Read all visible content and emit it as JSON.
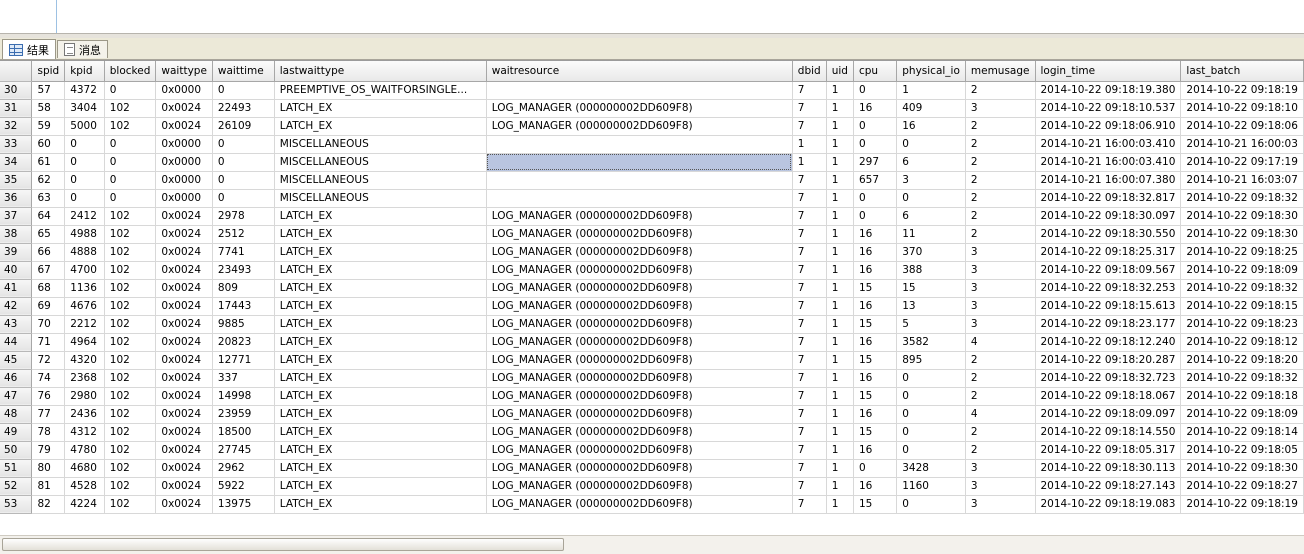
{
  "tabs": [
    {
      "label": "结果",
      "icon": "grid-results-icon",
      "active": true
    },
    {
      "label": "消息",
      "icon": "messages-icon",
      "active": false
    }
  ],
  "grid": {
    "columns": [
      "spid",
      "kpid",
      "blocked",
      "waittype",
      "waittime",
      "lastwaittype",
      "waitresource",
      "dbid",
      "uid",
      "cpu",
      "physical_io",
      "memusage",
      "login_time",
      "last_batch"
    ],
    "rows": [
      [
        "30",
        "57",
        "4372",
        "0",
        "0x0000",
        "0",
        "PREEMPTIVE_OS_WAITFORSINGLE...",
        "",
        "7",
        "1",
        "0",
        "1",
        "2",
        "2014-10-22 09:18:19.380",
        "2014-10-22 09:18:19"
      ],
      [
        "31",
        "58",
        "3404",
        "102",
        "0x0024",
        "22493",
        "LATCH_EX",
        "LOG_MANAGER (000000002DD609F8)",
        "7",
        "1",
        "16",
        "409",
        "3",
        "2014-10-22 09:18:10.537",
        "2014-10-22 09:18:10"
      ],
      [
        "32",
        "59",
        "5000",
        "102",
        "0x0024",
        "26109",
        "LATCH_EX",
        "LOG_MANAGER (000000002DD609F8)",
        "7",
        "1",
        "0",
        "16",
        "2",
        "2014-10-22 09:18:06.910",
        "2014-10-22 09:18:06"
      ],
      [
        "33",
        "60",
        "0",
        "0",
        "0x0000",
        "0",
        "MISCELLANEOUS",
        "",
        "1",
        "1",
        "0",
        "0",
        "2",
        "2014-10-21 16:00:03.410",
        "2014-10-21 16:00:03"
      ],
      [
        "34",
        "61",
        "0",
        "0",
        "0x0000",
        "0",
        "MISCELLANEOUS",
        "",
        "1",
        "1",
        "297",
        "6",
        "2",
        "2014-10-21 16:00:03.410",
        "2014-10-22 09:17:19"
      ],
      [
        "35",
        "62",
        "0",
        "0",
        "0x0000",
        "0",
        "MISCELLANEOUS",
        "",
        "7",
        "1",
        "657",
        "3",
        "2",
        "2014-10-21 16:00:07.380",
        "2014-10-21 16:03:07"
      ],
      [
        "36",
        "63",
        "0",
        "0",
        "0x0000",
        "0",
        "MISCELLANEOUS",
        "",
        "7",
        "1",
        "0",
        "0",
        "2",
        "2014-10-22 09:18:32.817",
        "2014-10-22 09:18:32"
      ],
      [
        "37",
        "64",
        "2412",
        "102",
        "0x0024",
        "2978",
        "LATCH_EX",
        "LOG_MANAGER (000000002DD609F8)",
        "7",
        "1",
        "0",
        "6",
        "2",
        "2014-10-22 09:18:30.097",
        "2014-10-22 09:18:30"
      ],
      [
        "38",
        "65",
        "4988",
        "102",
        "0x0024",
        "2512",
        "LATCH_EX",
        "LOG_MANAGER (000000002DD609F8)",
        "7",
        "1",
        "16",
        "11",
        "2",
        "2014-10-22 09:18:30.550",
        "2014-10-22 09:18:30"
      ],
      [
        "39",
        "66",
        "4888",
        "102",
        "0x0024",
        "7741",
        "LATCH_EX",
        "LOG_MANAGER (000000002DD609F8)",
        "7",
        "1",
        "16",
        "370",
        "3",
        "2014-10-22 09:18:25.317",
        "2014-10-22 09:18:25"
      ],
      [
        "40",
        "67",
        "4700",
        "102",
        "0x0024",
        "23493",
        "LATCH_EX",
        "LOG_MANAGER (000000002DD609F8)",
        "7",
        "1",
        "16",
        "388",
        "3",
        "2014-10-22 09:18:09.567",
        "2014-10-22 09:18:09"
      ],
      [
        "41",
        "68",
        "1136",
        "102",
        "0x0024",
        "809",
        "LATCH_EX",
        "LOG_MANAGER (000000002DD609F8)",
        "7",
        "1",
        "15",
        "15",
        "3",
        "2014-10-22 09:18:32.253",
        "2014-10-22 09:18:32"
      ],
      [
        "42",
        "69",
        "4676",
        "102",
        "0x0024",
        "17443",
        "LATCH_EX",
        "LOG_MANAGER (000000002DD609F8)",
        "7",
        "1",
        "16",
        "13",
        "3",
        "2014-10-22 09:18:15.613",
        "2014-10-22 09:18:15"
      ],
      [
        "43",
        "70",
        "2212",
        "102",
        "0x0024",
        "9885",
        "LATCH_EX",
        "LOG_MANAGER (000000002DD609F8)",
        "7",
        "1",
        "15",
        "5",
        "3",
        "2014-10-22 09:18:23.177",
        "2014-10-22 09:18:23"
      ],
      [
        "44",
        "71",
        "4964",
        "102",
        "0x0024",
        "20823",
        "LATCH_EX",
        "LOG_MANAGER (000000002DD609F8)",
        "7",
        "1",
        "16",
        "3582",
        "4",
        "2014-10-22 09:18:12.240",
        "2014-10-22 09:18:12"
      ],
      [
        "45",
        "72",
        "4320",
        "102",
        "0x0024",
        "12771",
        "LATCH_EX",
        "LOG_MANAGER (000000002DD609F8)",
        "7",
        "1",
        "15",
        "895",
        "2",
        "2014-10-22 09:18:20.287",
        "2014-10-22 09:18:20"
      ],
      [
        "46",
        "74",
        "2368",
        "102",
        "0x0024",
        "337",
        "LATCH_EX",
        "LOG_MANAGER (000000002DD609F8)",
        "7",
        "1",
        "16",
        "0",
        "2",
        "2014-10-22 09:18:32.723",
        "2014-10-22 09:18:32"
      ],
      [
        "47",
        "76",
        "2980",
        "102",
        "0x0024",
        "14998",
        "LATCH_EX",
        "LOG_MANAGER (000000002DD609F8)",
        "7",
        "1",
        "15",
        "0",
        "2",
        "2014-10-22 09:18:18.067",
        "2014-10-22 09:18:18"
      ],
      [
        "48",
        "77",
        "2436",
        "102",
        "0x0024",
        "23959",
        "LATCH_EX",
        "LOG_MANAGER (000000002DD609F8)",
        "7",
        "1",
        "16",
        "0",
        "4",
        "2014-10-22 09:18:09.097",
        "2014-10-22 09:18:09"
      ],
      [
        "49",
        "78",
        "4312",
        "102",
        "0x0024",
        "18500",
        "LATCH_EX",
        "LOG_MANAGER (000000002DD609F8)",
        "7",
        "1",
        "15",
        "0",
        "2",
        "2014-10-22 09:18:14.550",
        "2014-10-22 09:18:14"
      ],
      [
        "50",
        "79",
        "4780",
        "102",
        "0x0024",
        "27745",
        "LATCH_EX",
        "LOG_MANAGER (000000002DD609F8)",
        "7",
        "1",
        "16",
        "0",
        "2",
        "2014-10-22 09:18:05.317",
        "2014-10-22 09:18:05"
      ],
      [
        "51",
        "80",
        "4680",
        "102",
        "0x0024",
        "2962",
        "LATCH_EX",
        "LOG_MANAGER (000000002DD609F8)",
        "7",
        "1",
        "0",
        "3428",
        "3",
        "2014-10-22 09:18:30.113",
        "2014-10-22 09:18:30"
      ],
      [
        "52",
        "81",
        "4528",
        "102",
        "0x0024",
        "5922",
        "LATCH_EX",
        "LOG_MANAGER (000000002DD609F8)",
        "7",
        "1",
        "16",
        "1160",
        "3",
        "2014-10-22 09:18:27.143",
        "2014-10-22 09:18:27"
      ],
      [
        "53",
        "82",
        "4224",
        "102",
        "0x0024",
        "13975",
        "LATCH_EX",
        "LOG_MANAGER (000000002DD609F8)",
        "7",
        "1",
        "15",
        "0",
        "3",
        "2014-10-22 09:18:19.083",
        "2014-10-22 09:18:19"
      ]
    ],
    "selected_cell": {
      "row": 4,
      "column": "waitresource"
    },
    "selected_color": "#b9c5e0"
  }
}
